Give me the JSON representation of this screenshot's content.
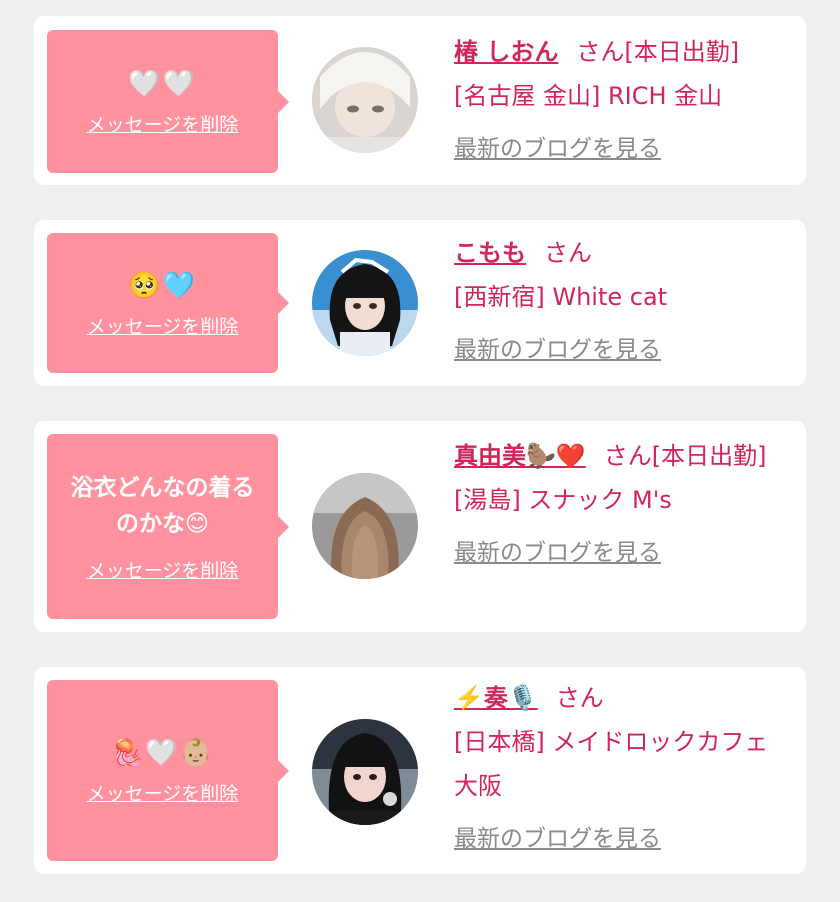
{
  "common": {
    "delete_label": "メッセージを削除",
    "san": "さん",
    "blog_label": "最新のブログを見る"
  },
  "colors": {
    "background": "#efefef",
    "card": "#ffffff",
    "bubble": "#ff929e",
    "accent": "#d2255a",
    "link_gray": "#8a8a8a"
  },
  "entries": [
    {
      "message": "🤍🤍",
      "name": "椿 しおん",
      "suffix": "[本日出勤]",
      "shop": "[名古屋 金山] RICH 金山"
    },
    {
      "message": "🥺🩵",
      "name": "こもも",
      "suffix": "",
      "shop": "[西新宿] White cat"
    },
    {
      "message": "浴衣どんなの着るのかな😊",
      "name": "真由美🦫❤️",
      "suffix": "[本日出勤]",
      "shop": "[湯島] スナック M's"
    },
    {
      "message": "🪼🤍👶🏼",
      "name": "⚡️奏🎙️",
      "suffix": "",
      "shop": "[日本橋] メイドロックカフェ 大阪"
    }
  ]
}
